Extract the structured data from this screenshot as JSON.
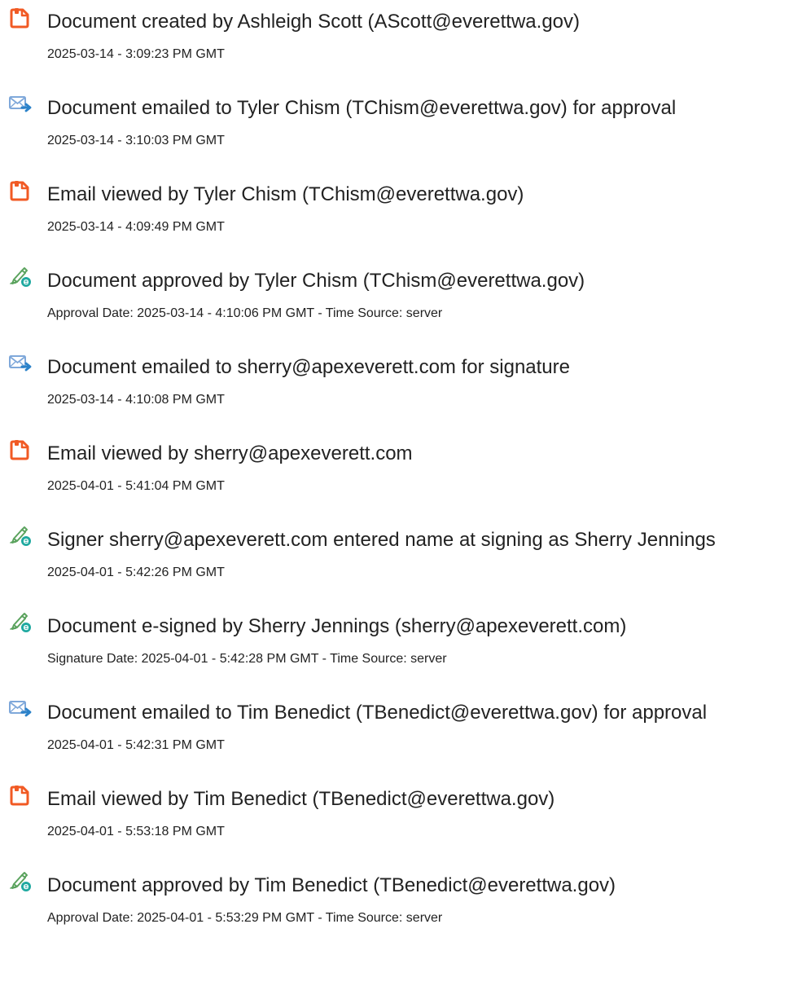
{
  "entries": [
    {
      "type": "document",
      "icon": "document-created-icon",
      "title": "Document created by Ashleigh Scott (AScott@everettwa.gov)",
      "sub": "2025-03-14 - 3:09:23 PM GMT"
    },
    {
      "type": "email",
      "icon": "email-sent-icon",
      "title": "Document emailed to Tyler Chism (TChism@everettwa.gov) for approval",
      "sub": "2025-03-14 - 3:10:03 PM GMT"
    },
    {
      "type": "document",
      "icon": "email-viewed-icon",
      "title": "Email viewed by Tyler Chism (TChism@everettwa.gov)",
      "sub": "2025-03-14 - 4:09:49 PM GMT"
    },
    {
      "type": "sign",
      "icon": "e-sign-icon",
      "title": "Document approved by Tyler Chism (TChism@everettwa.gov)",
      "sub": "Approval Date: 2025-03-14 - 4:10:06 PM GMT - Time Source: server"
    },
    {
      "type": "email",
      "icon": "email-sent-icon",
      "title": "Document emailed to sherry@apexeverett.com for signature",
      "sub": "2025-03-14 - 4:10:08 PM GMT"
    },
    {
      "type": "document",
      "icon": "email-viewed-icon",
      "title": "Email viewed by sherry@apexeverett.com",
      "sub": "2025-04-01 - 5:41:04 PM GMT"
    },
    {
      "type": "sign",
      "icon": "e-sign-icon",
      "title": "Signer sherry@apexeverett.com entered name at signing as Sherry Jennings",
      "sub": "2025-04-01 - 5:42:26 PM GMT"
    },
    {
      "type": "sign",
      "icon": "e-sign-icon",
      "title": "Document e-signed by Sherry Jennings (sherry@apexeverett.com)",
      "sub": "Signature Date: 2025-04-01 - 5:42:28 PM GMT - Time Source: server"
    },
    {
      "type": "email",
      "icon": "email-sent-icon",
      "title": "Document emailed to Tim Benedict (TBenedict@everettwa.gov) for approval",
      "sub": "2025-04-01 - 5:42:31 PM GMT"
    },
    {
      "type": "document",
      "icon": "email-viewed-icon",
      "title": "Email viewed by Tim Benedict (TBenedict@everettwa.gov)",
      "sub": "2025-04-01 - 5:53:18 PM GMT"
    },
    {
      "type": "sign",
      "icon": "e-sign-icon",
      "title": "Document approved by Tim Benedict (TBenedict@everettwa.gov)",
      "sub": "Approval Date: 2025-04-01 - 5:53:29 PM GMT - Time Source: server"
    }
  ],
  "colors": {
    "document_icon": "#F15A24",
    "email_icon": "#7FA8DA",
    "email_arrow": "#2B82C9",
    "sign_pen": "#5BA35E",
    "sign_badge": "#1FA9A0",
    "text": "#222222"
  }
}
